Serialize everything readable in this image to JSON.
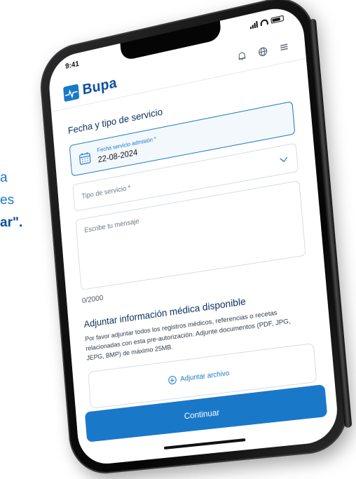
{
  "side_text": {
    "line1": "a",
    "line2": "es",
    "line3": "ar\"."
  },
  "status_bar": {
    "time": "9:41"
  },
  "header": {
    "brand": "Bupa",
    "icons": [
      "bell-icon",
      "globe-icon",
      "menu-icon"
    ]
  },
  "form": {
    "section_title": "Fecha y tipo de servicio",
    "date_label": "Fecha servicio admisión *",
    "date_value": "22-08-2024",
    "service_type_placeholder": "Tipo de servicio *",
    "message_placeholder": "Escribe tu mensaje",
    "counter": "0/2000"
  },
  "attachments": {
    "title": "Adjuntar información médica disponible",
    "description": "Por favor adjuntar todos los registros médicos, referencias o recetas relacionadas con esta pre-autorización. Adjunte documentos (PDF, JPG, JEPG, BMP) de máximo 25MB.",
    "button_label": "Adjuntar archivo"
  },
  "actions": {
    "continue_label": "Continuar"
  },
  "colors": {
    "brand": "#0a4f9c",
    "accent": "#1a78c9"
  }
}
